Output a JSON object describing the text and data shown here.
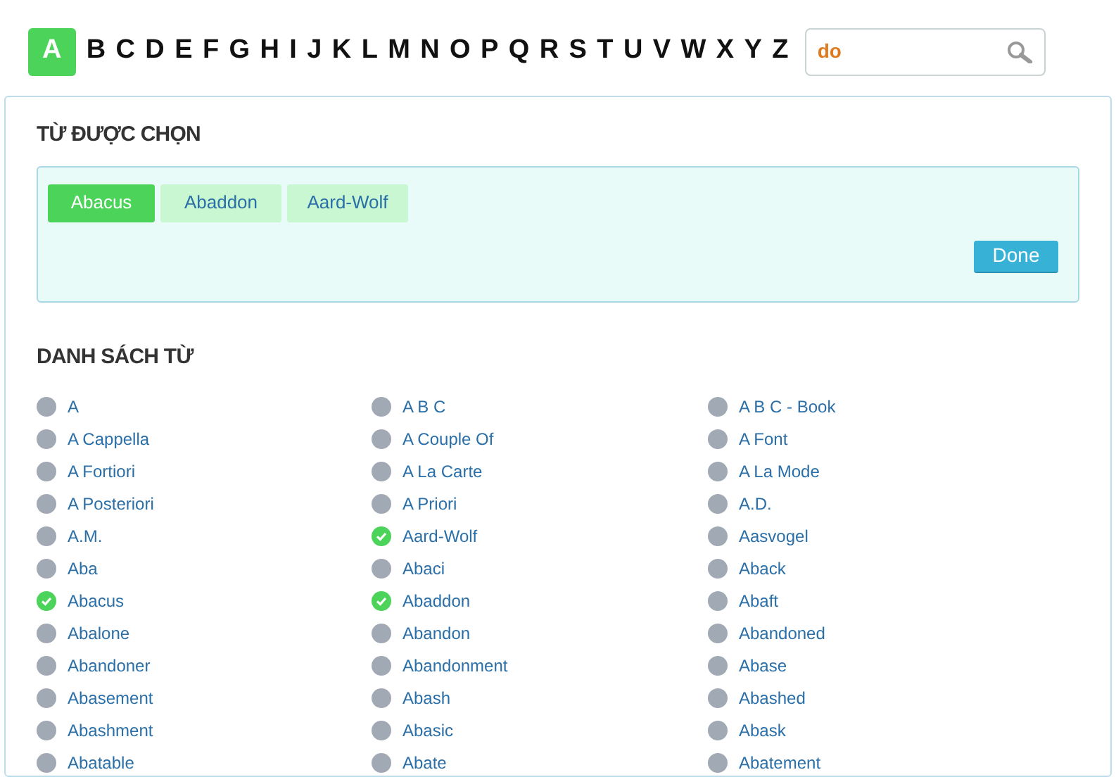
{
  "alphabet": [
    {
      "letter": "A",
      "selected": true
    },
    {
      "letter": "B",
      "selected": false
    },
    {
      "letter": "C",
      "selected": false
    },
    {
      "letter": "D",
      "selected": false
    },
    {
      "letter": "E",
      "selected": false
    },
    {
      "letter": "F",
      "selected": false
    },
    {
      "letter": "G",
      "selected": false
    },
    {
      "letter": "H",
      "selected": false
    },
    {
      "letter": "I",
      "selected": false
    },
    {
      "letter": "J",
      "selected": false
    },
    {
      "letter": "K",
      "selected": false
    },
    {
      "letter": "L",
      "selected": false
    },
    {
      "letter": "M",
      "selected": false
    },
    {
      "letter": "N",
      "selected": false
    },
    {
      "letter": "O",
      "selected": false
    },
    {
      "letter": "P",
      "selected": false
    },
    {
      "letter": "Q",
      "selected": false
    },
    {
      "letter": "R",
      "selected": false
    },
    {
      "letter": "S",
      "selected": false
    },
    {
      "letter": "T",
      "selected": false
    },
    {
      "letter": "U",
      "selected": false
    },
    {
      "letter": "V",
      "selected": false
    },
    {
      "letter": "W",
      "selected": false
    },
    {
      "letter": "X",
      "selected": false
    },
    {
      "letter": "Y",
      "selected": false
    },
    {
      "letter": "Z",
      "selected": false
    }
  ],
  "search": {
    "value": "do"
  },
  "selected_words": {
    "title": "TỪ ĐƯỢC CHỌN",
    "chips": [
      {
        "label": "Abacus",
        "selected": true
      },
      {
        "label": "Abaddon",
        "selected": false
      },
      {
        "label": "Aard-Wolf",
        "selected": false
      }
    ],
    "done_button": "Done"
  },
  "word_list": {
    "title": "DANH SÁCH TỪ",
    "words": [
      {
        "label": "A",
        "checked": false
      },
      {
        "label": "A B C",
        "checked": false
      },
      {
        "label": "A B C - Book",
        "checked": false
      },
      {
        "label": "A Cappella",
        "checked": false
      },
      {
        "label": "A Couple Of",
        "checked": false
      },
      {
        "label": "A Font",
        "checked": false
      },
      {
        "label": "A Fortiori",
        "checked": false
      },
      {
        "label": "A La Carte",
        "checked": false
      },
      {
        "label": "A La Mode",
        "checked": false
      },
      {
        "label": "A Posteriori",
        "checked": false
      },
      {
        "label": "A Priori",
        "checked": false
      },
      {
        "label": "A.D.",
        "checked": false
      },
      {
        "label": "A.M.",
        "checked": false
      },
      {
        "label": "Aard-Wolf",
        "checked": true
      },
      {
        "label": "Aasvogel",
        "checked": false
      },
      {
        "label": "Aba",
        "checked": false
      },
      {
        "label": "Abaci",
        "checked": false
      },
      {
        "label": "Aback",
        "checked": false
      },
      {
        "label": "Abacus",
        "checked": true
      },
      {
        "label": "Abaddon",
        "checked": true
      },
      {
        "label": "Abaft",
        "checked": false
      },
      {
        "label": "Abalone",
        "checked": false
      },
      {
        "label": "Abandon",
        "checked": false
      },
      {
        "label": "Abandoned",
        "checked": false
      },
      {
        "label": "Abandoner",
        "checked": false
      },
      {
        "label": "Abandonment",
        "checked": false
      },
      {
        "label": "Abase",
        "checked": false
      },
      {
        "label": "Abasement",
        "checked": false
      },
      {
        "label": "Abash",
        "checked": false
      },
      {
        "label": "Abashed",
        "checked": false
      },
      {
        "label": "Abashment",
        "checked": false
      },
      {
        "label": "Abasic",
        "checked": false
      },
      {
        "label": "Abask",
        "checked": false
      },
      {
        "label": "Abatable",
        "checked": false
      },
      {
        "label": "Abate",
        "checked": false
      },
      {
        "label": "Abatement",
        "checked": false
      }
    ]
  }
}
